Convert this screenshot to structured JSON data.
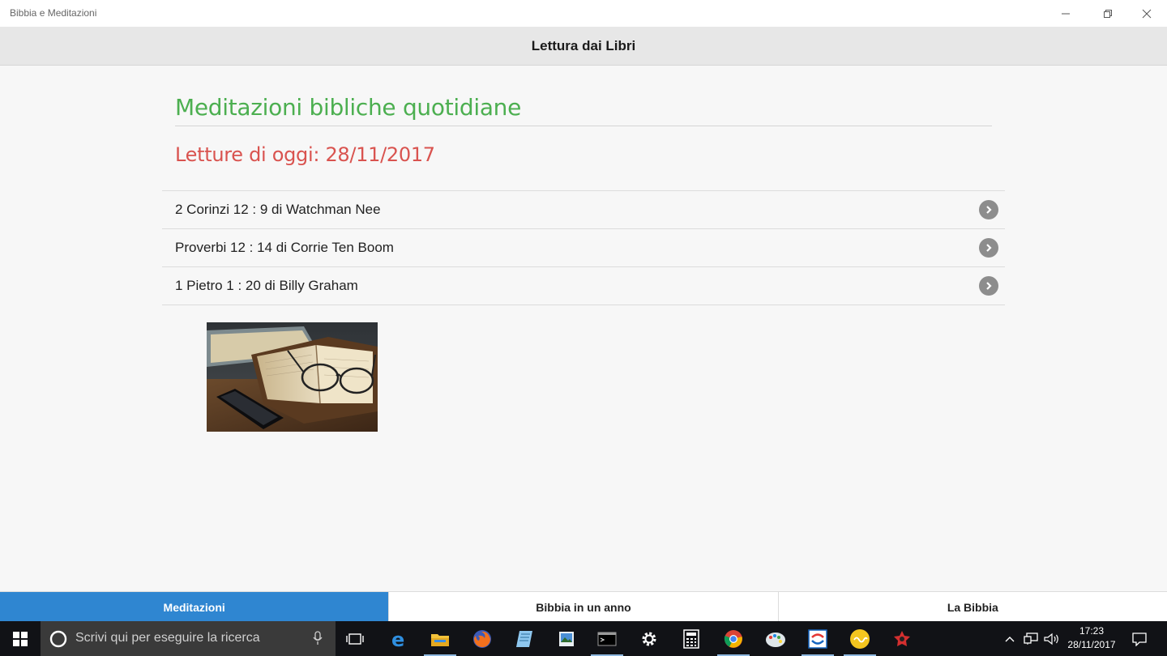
{
  "window": {
    "title": "Bibbia e Meditazioni",
    "controls": [
      "minimize-icon",
      "restore-icon",
      "close-icon"
    ]
  },
  "header": {
    "title": "Lettura dai Libri"
  },
  "main": {
    "section_title": "Meditazioni bibliche quotidiane",
    "date_title": "Letture di oggi: 28/11/2017",
    "readings": [
      {
        "label": "2 Corinzi 12 : 9 di Watchman Nee",
        "icon": "chevron-right-circle-icon"
      },
      {
        "label": "Proverbi 12 : 14 di Corrie Ten Boom",
        "icon": "chevron-right-circle-icon"
      },
      {
        "label": "1 Pietro 1 : 20 di Billy Graham",
        "icon": "chevron-right-circle-icon"
      }
    ],
    "image": {
      "icon": "book-glasses-phone-photo"
    }
  },
  "tabs": [
    {
      "label": "Meditazioni",
      "active": true
    },
    {
      "label": "Bibbia in un anno",
      "active": false
    },
    {
      "label": "La Bibbia",
      "active": false
    }
  ],
  "colors": {
    "section_title": "#4caf50",
    "date_title": "#d9534f",
    "active_tab": "#2f86d1",
    "taskbar": "#111216"
  },
  "taskbar": {
    "search_placeholder": "Scrivi qui per eseguire la ricerca",
    "apps": [
      "task-view-icon",
      "edge-icon",
      "file-explorer-icon",
      "firefox-icon",
      "notepad-icon",
      "photo-icon",
      "terminal-icon",
      "settings-icon",
      "calculator-icon",
      "chrome-icon",
      "paint-icon",
      "app-icon",
      "weather-icon",
      "game-icon"
    ],
    "tray": [
      "chevron-up-icon",
      "network-icon",
      "volume-icon",
      "notification-icon"
    ],
    "time": "17:23",
    "date": "28/11/2017"
  }
}
